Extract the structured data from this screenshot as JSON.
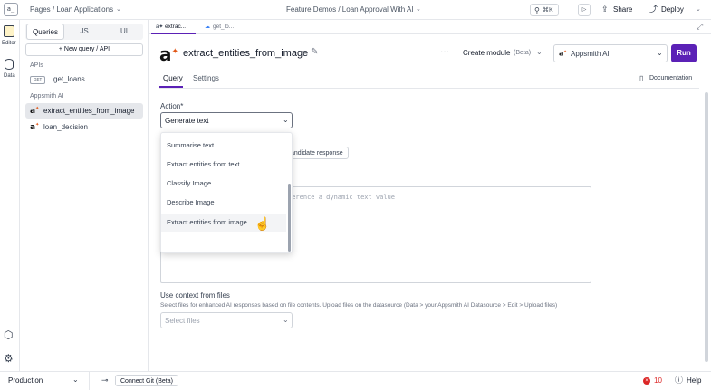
{
  "topbar": {
    "breadcrumb": "Pages / Loan Applications",
    "app_title": "Feature Demos / Loan Approval With AI",
    "search_shortcut": "⌘K",
    "share_label": "Share",
    "deploy_label": "Deploy"
  },
  "iconrail": {
    "editor_label": "Editor",
    "data_label": "Data"
  },
  "sidebar": {
    "tabs": [
      "Queries",
      "JS",
      "UI"
    ],
    "new_query_label": "+ New query / API",
    "apis_header": "APIs",
    "api_items": [
      {
        "method": "GET",
        "name": "get_loans"
      }
    ],
    "ai_header": "Appsmith AI",
    "ai_items": [
      {
        "name": "extract_entities_from_image"
      },
      {
        "name": "loan_decision"
      }
    ]
  },
  "editor_tabs": [
    "extrac...",
    "get_lo..."
  ],
  "query": {
    "name": "extract_entities_from_image",
    "create_module_label": "Create module",
    "create_module_badge": "(Beta)",
    "datasource": "Appsmith AI",
    "run_label": "Run",
    "subtabs": [
      "Query",
      "Settings"
    ],
    "documentation_label": "Documentation",
    "action_label": "Action*",
    "action_value": "Generate text",
    "candidate_response_label": "andidate response",
    "prompt_placeholder": "ference a dynamic text value",
    "context_label": "Use context from files",
    "context_help": "Select files for enhanced AI responses based on file contents. Upload files on the datasource (Data > your Appsmith AI Datasource > Edit > Upload files)",
    "select_files_placeholder": "Select files"
  },
  "dropdown": {
    "options": [
      "Summarise text",
      "Extract entities from text",
      "Classify Image",
      "Describe Image",
      "Extract entities from image"
    ],
    "hovered_index": 4
  },
  "bottombar": {
    "environment": "Production",
    "connect_git_label": "Connect Git (Beta)",
    "error_count": "10",
    "help_label": "Help"
  },
  "colors": {
    "accent": "#5b21b6",
    "error": "#dc2626",
    "selected_bg": "#e5e7eb"
  }
}
